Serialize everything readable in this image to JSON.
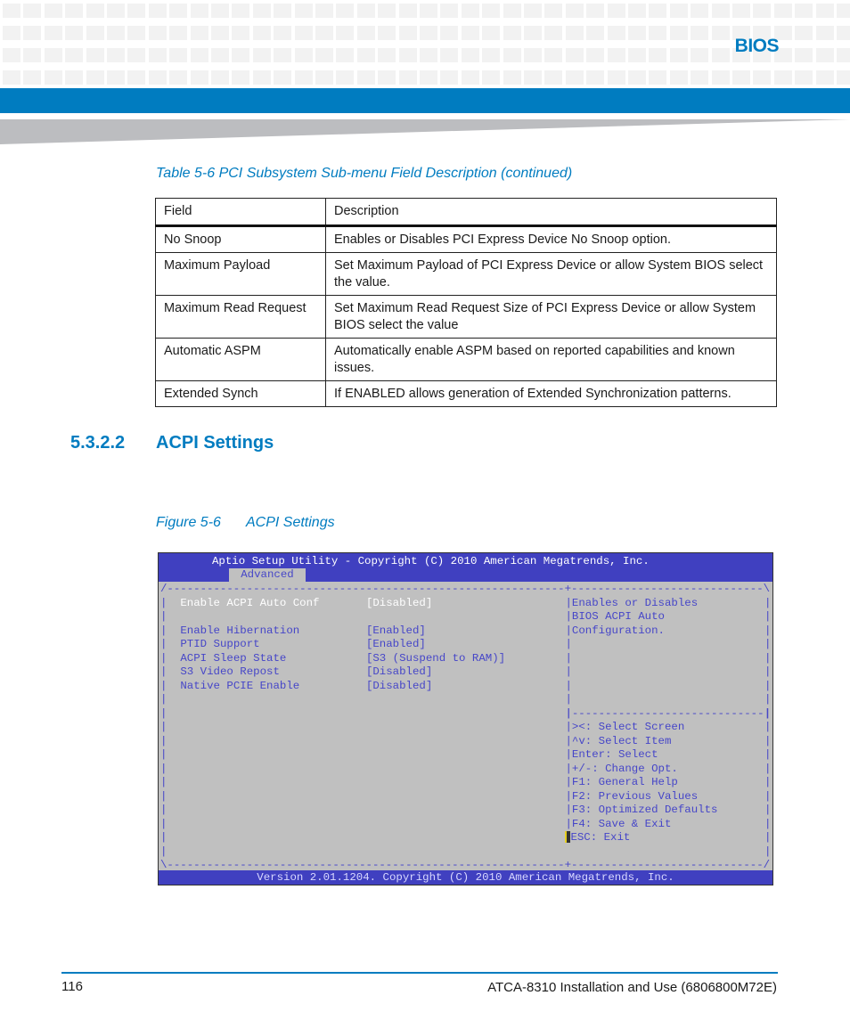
{
  "header": {
    "section_label": "BIOS"
  },
  "table": {
    "caption": "Table 5-6 PCI Subsystem Sub-menu Field Description (continued)",
    "columns": [
      "Field",
      "Description"
    ],
    "rows": [
      {
        "field": "No Snoop",
        "description": "Enables or Disables PCI Express Device No Snoop option."
      },
      {
        "field": "Maximum Payload",
        "description": "Set Maximum Payload of PCI Express Device or allow System BIOS select the value."
      },
      {
        "field": "Maximum Read Request",
        "description": "Set Maximum Read Request Size of PCI Express Device or allow System BIOS select the value"
      },
      {
        "field": "Automatic ASPM",
        "description": "Automatically enable ASPM based on reported capabilities and known issues."
      },
      {
        "field": "Extended Synch",
        "description": "If ENABLED allows generation of Extended Synchronization patterns."
      }
    ]
  },
  "section": {
    "number": "5.3.2.2",
    "title": "ACPI Settings"
  },
  "figure": {
    "number": "Figure 5-6",
    "title": "ACPI Settings"
  },
  "bios": {
    "title": "Aptio Setup Utility - Copyright (C) 2010 American Megatrends, Inc.",
    "active_tab": "Advanced",
    "settings": [
      {
        "name": "Enable ACPI Auto Conf",
        "value": "[Disabled]",
        "selected": true
      },
      {
        "name": "Enable Hibernation",
        "value": "[Enabled]"
      },
      {
        "name": "PTID Support",
        "value": "[Enabled]"
      },
      {
        "name": "ACPI Sleep State",
        "value": "[S3 (Suspend to RAM)]"
      },
      {
        "name": "S3 Video Repost",
        "value": "[Disabled]"
      },
      {
        "name": "Native PCIE Enable",
        "value": "[Disabled]"
      }
    ],
    "help_text": [
      "Enables or Disables",
      "BIOS ACPI Auto",
      "Configuration."
    ],
    "keys": [
      "><: Select Screen",
      "^v: Select Item",
      "Enter: Select",
      "+/-: Change Opt.",
      "F1: General Help",
      "F2: Previous Values",
      "F3: Optimized Defaults",
      "F4: Save & Exit",
      "ESC: Exit"
    ],
    "version": "Version 2.01.1204. Copyright (C) 2010 American Megatrends, Inc.",
    "colors": {
      "title_bar": "#4040c0",
      "body": "#c0c0c0",
      "text": "#4646c8",
      "selected_text": "#ffffff"
    }
  },
  "footer": {
    "page_number": "116",
    "doc_title": "ATCA-8310 Installation and Use (6806800M72E)"
  },
  "brand_color": "#007cc0"
}
